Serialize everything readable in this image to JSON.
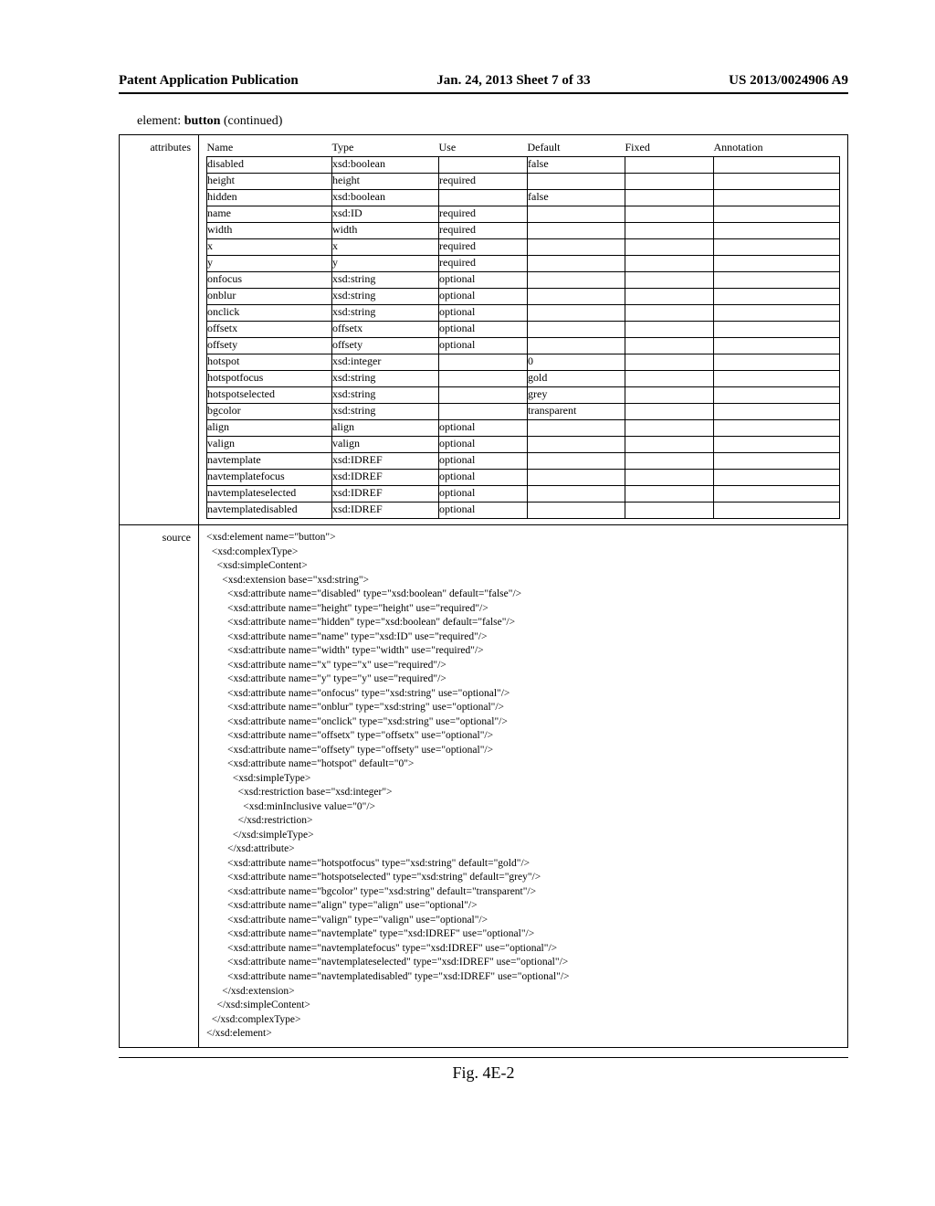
{
  "header": {
    "left": "Patent Application Publication",
    "center": "Jan. 24, 2013   Sheet 7 of 33",
    "right": "US 2013/0024906 A9"
  },
  "caption": {
    "prefix": "element: ",
    "bold": "button",
    "suffix": " (continued)"
  },
  "attr_section_label": "attributes",
  "source_section_label": "source",
  "attr_headers": [
    "Name",
    "Type",
    "Use",
    "Default",
    "Fixed",
    "Annotation"
  ],
  "attributes": [
    {
      "name": "disabled",
      "type": "xsd:boolean",
      "use": "",
      "default": "false",
      "fixed": "",
      "annotation": ""
    },
    {
      "name": "height",
      "type": "height",
      "use": "required",
      "default": "",
      "fixed": "",
      "annotation": ""
    },
    {
      "name": "hidden",
      "type": "xsd:boolean",
      "use": "",
      "default": "false",
      "fixed": "",
      "annotation": ""
    },
    {
      "name": "name",
      "type": "xsd:ID",
      "use": "required",
      "default": "",
      "fixed": "",
      "annotation": ""
    },
    {
      "name": "width",
      "type": "width",
      "use": "required",
      "default": "",
      "fixed": "",
      "annotation": ""
    },
    {
      "name": "x",
      "type": "x",
      "use": "required",
      "default": "",
      "fixed": "",
      "annotation": ""
    },
    {
      "name": "y",
      "type": "y",
      "use": "required",
      "default": "",
      "fixed": "",
      "annotation": ""
    },
    {
      "name": "onfocus",
      "type": "xsd:string",
      "use": "optional",
      "default": "",
      "fixed": "",
      "annotation": ""
    },
    {
      "name": "onblur",
      "type": "xsd:string",
      "use": "optional",
      "default": "",
      "fixed": "",
      "annotation": ""
    },
    {
      "name": "onclick",
      "type": "xsd:string",
      "use": "optional",
      "default": "",
      "fixed": "",
      "annotation": ""
    },
    {
      "name": "offsetx",
      "type": "offsetx",
      "use": "optional",
      "default": "",
      "fixed": "",
      "annotation": ""
    },
    {
      "name": "offsety",
      "type": "offsety",
      "use": "optional",
      "default": "",
      "fixed": "",
      "annotation": ""
    },
    {
      "name": "hotspot",
      "type": "xsd:integer",
      "use": "",
      "default": "0",
      "fixed": "",
      "annotation": ""
    },
    {
      "name": "hotspotfocus",
      "type": "xsd:string",
      "use": "",
      "default": "gold",
      "fixed": "",
      "annotation": ""
    },
    {
      "name": "hotspotselected",
      "type": "xsd:string",
      "use": "",
      "default": "grey",
      "fixed": "",
      "annotation": ""
    },
    {
      "name": "bgcolor",
      "type": "xsd:string",
      "use": "",
      "default": "transparent",
      "fixed": "",
      "annotation": ""
    },
    {
      "name": "align",
      "type": "align",
      "use": "optional",
      "default": "",
      "fixed": "",
      "annotation": ""
    },
    {
      "name": "valign",
      "type": "valign",
      "use": "optional",
      "default": "",
      "fixed": "",
      "annotation": ""
    },
    {
      "name": "navtemplate",
      "type": "xsd:IDREF",
      "use": "optional",
      "default": "",
      "fixed": "",
      "annotation": ""
    },
    {
      "name": "navtemplatefocus",
      "type": "xsd:IDREF",
      "use": "optional",
      "default": "",
      "fixed": "",
      "annotation": ""
    },
    {
      "name": "navtemplateselected",
      "type": "xsd:IDREF",
      "use": "optional",
      "default": "",
      "fixed": "",
      "annotation": ""
    },
    {
      "name": "navtemplatedisabled",
      "type": "xsd:IDREF",
      "use": "optional",
      "default": "",
      "fixed": "",
      "annotation": ""
    }
  ],
  "source_code": "<xsd:element name=\"button\">\n  <xsd:complexType>\n    <xsd:simpleContent>\n      <xsd:extension base=\"xsd:string\">\n        <xsd:attribute name=\"disabled\" type=\"xsd:boolean\" default=\"false\"/>\n        <xsd:attribute name=\"height\" type=\"height\" use=\"required\"/>\n        <xsd:attribute name=\"hidden\" type=\"xsd:boolean\" default=\"false\"/>\n        <xsd:attribute name=\"name\" type=\"xsd:ID\" use=\"required\"/>\n        <xsd:attribute name=\"width\" type=\"width\" use=\"required\"/>\n        <xsd:attribute name=\"x\" type=\"x\" use=\"required\"/>\n        <xsd:attribute name=\"y\" type=\"y\" use=\"required\"/>\n        <xsd:attribute name=\"onfocus\" type=\"xsd:string\" use=\"optional\"/>\n        <xsd:attribute name=\"onblur\" type=\"xsd:string\" use=\"optional\"/>\n        <xsd:attribute name=\"onclick\" type=\"xsd:string\" use=\"optional\"/>\n        <xsd:attribute name=\"offsetx\" type=\"offsetx\" use=\"optional\"/>\n        <xsd:attribute name=\"offsety\" type=\"offsety\" use=\"optional\"/>\n        <xsd:attribute name=\"hotspot\" default=\"0\">\n          <xsd:simpleType>\n            <xsd:restriction base=\"xsd:integer\">\n              <xsd:minInclusive value=\"0\"/>\n            </xsd:restriction>\n          </xsd:simpleType>\n        </xsd:attribute>\n        <xsd:attribute name=\"hotspotfocus\" type=\"xsd:string\" default=\"gold\"/>\n        <xsd:attribute name=\"hotspotselected\" type=\"xsd:string\" default=\"grey\"/>\n        <xsd:attribute name=\"bgcolor\" type=\"xsd:string\" default=\"transparent\"/>\n        <xsd:attribute name=\"align\" type=\"align\" use=\"optional\"/>\n        <xsd:attribute name=\"valign\" type=\"valign\" use=\"optional\"/>\n        <xsd:attribute name=\"navtemplate\" type=\"xsd:IDREF\" use=\"optional\"/>\n        <xsd:attribute name=\"navtemplatefocus\" type=\"xsd:IDREF\" use=\"optional\"/>\n        <xsd:attribute name=\"navtemplateselected\" type=\"xsd:IDREF\" use=\"optional\"/>\n        <xsd:attribute name=\"navtemplatedisabled\" type=\"xsd:IDREF\" use=\"optional\"/>\n      </xsd:extension>\n    </xsd:simpleContent>\n  </xsd:complexType>\n</xsd:element>",
  "figure_label": "Fig. 4E-2"
}
